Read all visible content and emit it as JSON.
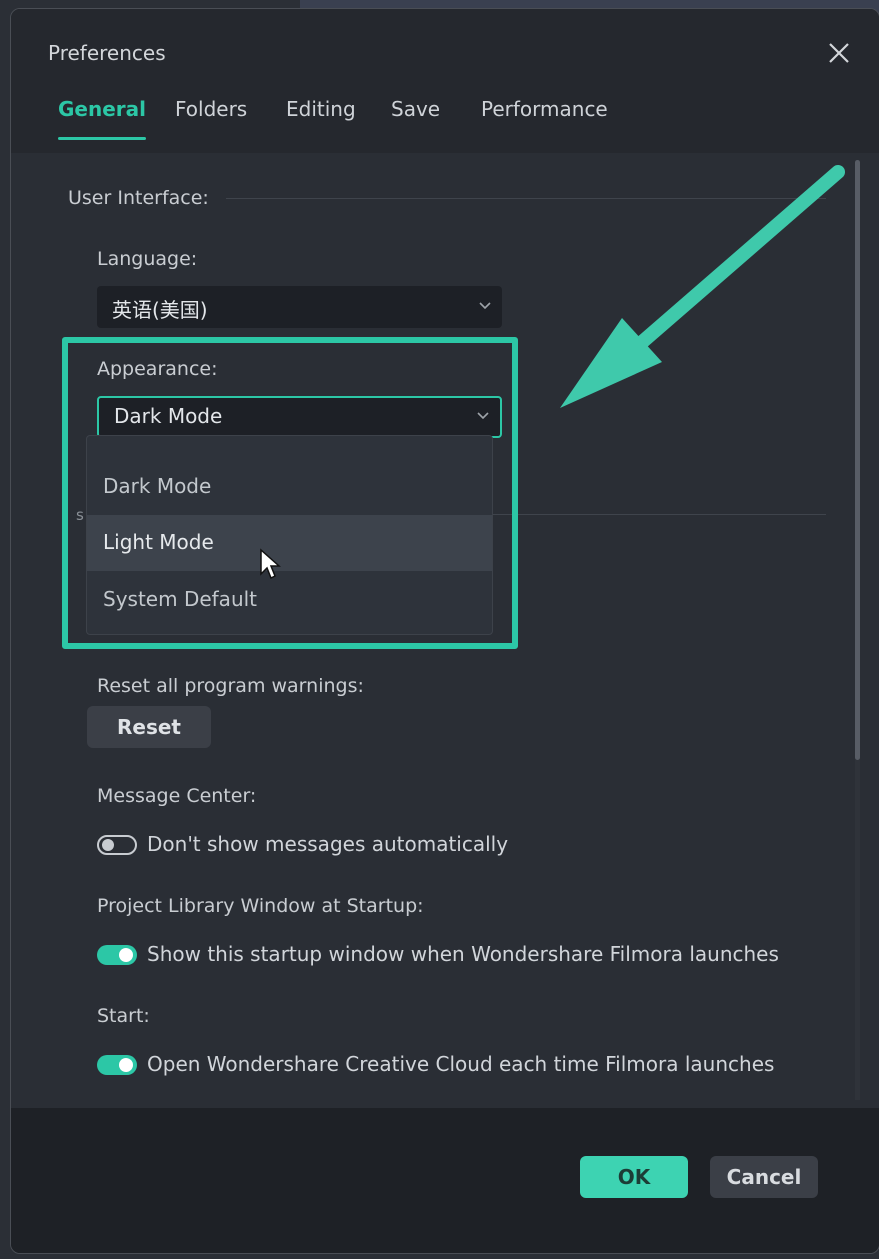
{
  "window": {
    "title": "Preferences"
  },
  "tabs": [
    {
      "label": "General",
      "active": true
    },
    {
      "label": "Folders",
      "active": false
    },
    {
      "label": "Editing",
      "active": false
    },
    {
      "label": "Save",
      "active": false
    },
    {
      "label": "Performance",
      "active": false
    }
  ],
  "user_interface": {
    "section_label": "User Interface:",
    "language": {
      "label": "Language:",
      "value": "英语(美国)"
    },
    "appearance": {
      "label": "Appearance:",
      "value": "Dark Mode",
      "options": [
        "Dark Mode",
        "Light Mode",
        "System Default"
      ],
      "hovered_option": "Light Mode"
    },
    "partial_text": "s"
  },
  "warnings": {
    "label": "Reset all program warnings:",
    "button": "Reset"
  },
  "message_center": {
    "label": "Message Center:",
    "toggle_text": "Don't show messages automatically",
    "toggle_on": false
  },
  "project_library": {
    "label": "Project Library Window at Startup:",
    "toggle_text": "Show this startup window when Wondershare Filmora launches",
    "toggle_on": true
  },
  "start": {
    "label": "Start:",
    "toggle_text": "Open Wondershare Creative Cloud each time Filmora launches",
    "toggle_on": true
  },
  "footer": {
    "ok_label": "OK",
    "cancel_label": "Cancel"
  },
  "colors": {
    "accent": "#2cc7a6",
    "background": "#2a2e35",
    "titlebar": "#25282e"
  },
  "icons": {
    "close": "close-icon",
    "chevron": "chevron-down-icon",
    "cursor": "mouse-pointer-icon",
    "annotation": "annotation-arrow"
  }
}
